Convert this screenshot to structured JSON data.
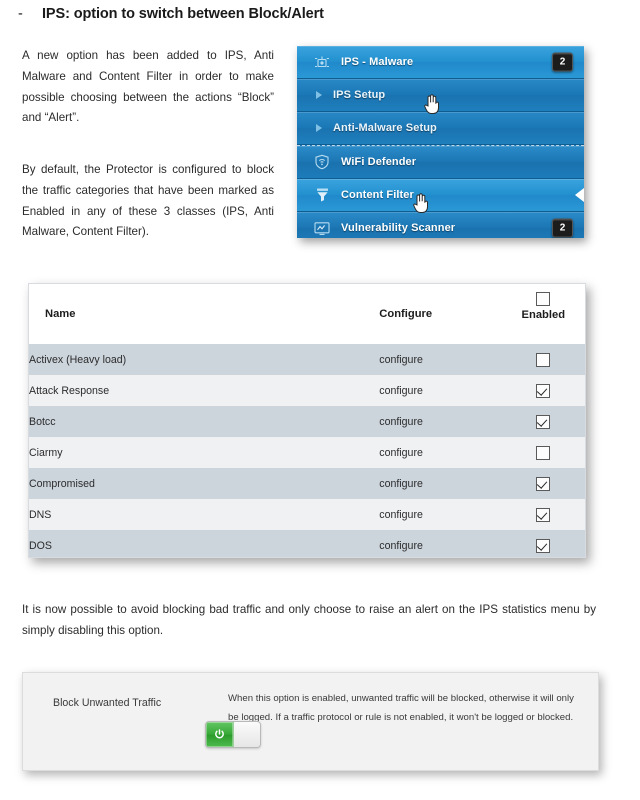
{
  "heading": {
    "bullet": "-",
    "text": "IPS: option to switch between Block/Alert"
  },
  "body": {
    "paragraph_1": "A new option has been added to IPS, Anti Malware and Content Filter in order to make possible choosing between the actions “Block” and “Alert”.",
    "paragraph_2": "By default, the Protector is configured to block the traffic categories that have been marked as Enabled in any of these 3 classes (IPS, Anti Malware, Content Filter).",
    "paragraph_3": "It is now possible to avoid blocking bad traffic and only choose to raise an alert on the IPS statistics menu by simply disabling this option."
  },
  "menu": {
    "items": [
      {
        "label": "IPS - Malware",
        "icon": "bug-shield-icon",
        "badge": "2",
        "style": "selected",
        "marker": "icon",
        "pointer": false
      },
      {
        "label": "IPS Setup",
        "icon": "arrow-right-icon",
        "badge": null,
        "style": "sub",
        "marker": "arrow",
        "pointer": false
      },
      {
        "label": "Anti-Malware Setup",
        "icon": "arrow-right-icon",
        "badge": null,
        "style": "sub",
        "marker": "arrow",
        "pointer": false
      },
      {
        "label": "WiFi Defender",
        "icon": "wifi-shield-icon",
        "badge": null,
        "style": "normal",
        "marker": "icon",
        "pointer": false
      },
      {
        "label": "Content Filter",
        "icon": "funnel-icon",
        "badge": null,
        "style": "selected",
        "marker": "icon",
        "pointer": true
      },
      {
        "label": "Vulnerability Scanner",
        "icon": "monitor-chart-icon",
        "badge": "2",
        "style": "normal",
        "marker": "icon",
        "pointer": false
      }
    ]
  },
  "table": {
    "columns": [
      "Name",
      "Configure",
      "Enabled"
    ],
    "header_checkbox_checked": false,
    "configure_link_label": "configure",
    "rows": [
      {
        "name": "Activex (Heavy load)",
        "configure": "configure",
        "enabled": false
      },
      {
        "name": "Attack Response",
        "configure": "configure",
        "enabled": true
      },
      {
        "name": "Botcc",
        "configure": "configure",
        "enabled": true
      },
      {
        "name": "Ciarmy",
        "configure": "configure",
        "enabled": false
      },
      {
        "name": "Compromised",
        "configure": "configure",
        "enabled": true
      },
      {
        "name": "DNS",
        "configure": "configure",
        "enabled": true
      },
      {
        "name": "DOS",
        "configure": "configure",
        "enabled": true
      }
    ]
  },
  "option_panel": {
    "label": "Block Unwanted Traffic",
    "description": "When this option is enabled, unwanted traffic will be blocked, otherwise it will only be logged. If a traffic protocol or rule is not enabled, it won't be logged or blocked.",
    "toggle_state": "on",
    "toggle_icon": "power-icon"
  },
  "colors": {
    "menu_blue": "#1d7fc0",
    "menu_blue_selected": "#2391cf",
    "badge_bg": "#1c1c1c",
    "row_odd": "#ccd4dc",
    "row_even": "#f0f1f3",
    "link": "#3b4a63",
    "toggle_green": "#36a836"
  }
}
